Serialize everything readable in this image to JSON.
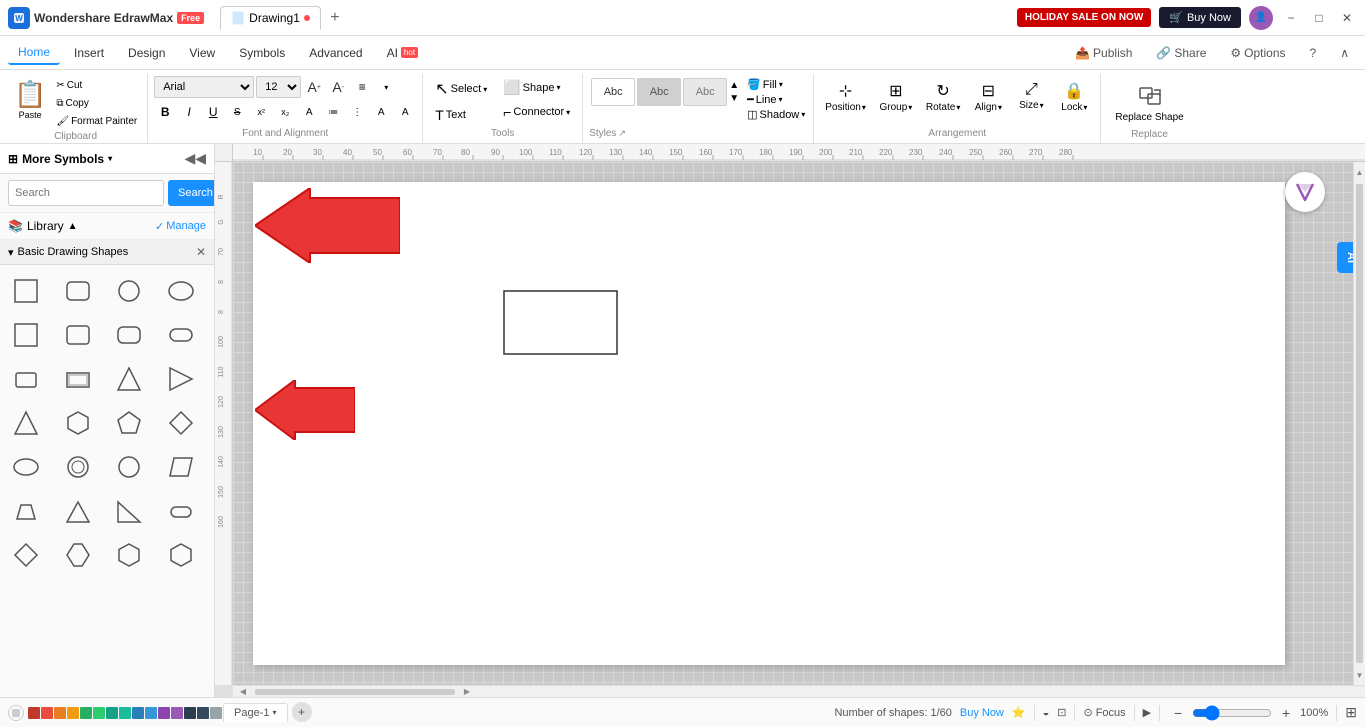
{
  "app": {
    "name": "Wondershare EdrawMax",
    "badge": "Free",
    "window_title": "Drawing1"
  },
  "titlebar": {
    "logo_text": "W",
    "app_name": "Wondershare EdrawMax",
    "free_label": "Free",
    "tab_name": "Drawing1",
    "holiday_btn": "HOLIDAY SALE ON NOW",
    "buy_btn": "Buy Now",
    "minimize": "−",
    "maximize": "□",
    "close": "✕"
  },
  "menubar": {
    "items": [
      {
        "label": "Home",
        "active": true
      },
      {
        "label": "Insert"
      },
      {
        "label": "Design"
      },
      {
        "label": "View"
      },
      {
        "label": "Symbols"
      },
      {
        "label": "Advanced"
      },
      {
        "label": "AI",
        "badge": "hot"
      }
    ],
    "right_actions": [
      {
        "label": "Publish"
      },
      {
        "label": "Share"
      },
      {
        "label": "Options"
      },
      {
        "label": "?"
      }
    ]
  },
  "ribbon": {
    "clipboard": {
      "label": "Clipboard",
      "paste_label": "Paste",
      "cut_label": "Cut",
      "copy_label": "Copy",
      "format_painter": "Format Painter"
    },
    "font": {
      "label": "Font and Alignment",
      "font_family": "Arial",
      "font_size": "12",
      "bold": "B",
      "italic": "I",
      "underline": "U",
      "strikethrough": "S",
      "superscript": "x²",
      "subscript": "x₂",
      "increase_size": "A+",
      "decrease_size": "A-",
      "align": "≡"
    },
    "tools": {
      "label": "Tools",
      "select_label": "Select",
      "shape_label": "Shape",
      "text_label": "Text",
      "connector_label": "Connector"
    },
    "styles": {
      "label": "Styles",
      "fill_label": "Fill",
      "line_label": "Line",
      "shadow_label": "Shadow"
    },
    "arrangement": {
      "label": "Arrangement",
      "position_label": "Position",
      "group_label": "Group",
      "rotate_label": "Rotate",
      "align_label": "Align",
      "size_label": "Size",
      "lock_label": "Lock"
    },
    "replace": {
      "label": "Replace",
      "replace_shape_label": "Replace Shape"
    }
  },
  "sidebar": {
    "title": "More Symbols",
    "search_placeholder": "Search",
    "search_btn": "Search",
    "library_label": "Library",
    "manage_label": "Manage",
    "shapes_section": "Basic Drawing Shapes",
    "shapes": [
      "square",
      "rounded-rect",
      "circle",
      "oval",
      "square2",
      "rounded-rect2",
      "rect-rounded",
      "stadium",
      "squircle",
      "rect-dark",
      "triangle",
      "triangle-right",
      "triangle2",
      "hexagon",
      "pentagon",
      "diamond",
      "ellipse",
      "circle-outline",
      "circle-outline2",
      "parallelogram",
      "trapezoid",
      "triangle3",
      "triangle4",
      "pill",
      "diamond2",
      "hexagon2",
      "hexagon3",
      "hexagon4"
    ]
  },
  "canvas": {
    "ruler_marks": [
      "10",
      "20",
      "30",
      "40",
      "50",
      "60",
      "70",
      "80",
      "90",
      "100",
      "110",
      "120",
      "130",
      "140",
      "150",
      "160",
      "170",
      "180",
      "190",
      "200",
      "210",
      "220",
      "230",
      "240",
      "250",
      "260",
      "270",
      "280"
    ],
    "ruler_v_marks": [
      "R",
      "G",
      "70",
      "8",
      "8",
      "100",
      "110",
      "120",
      "130",
      "140",
      "150",
      "160"
    ]
  },
  "statusbar": {
    "shape_count": "Number of shapes: 1/60",
    "buy_label": "Buy Now",
    "focus_label": "Focus",
    "zoom_level": "100%",
    "page_label": "Page-1"
  },
  "colors": {
    "primary": "#1890ff",
    "danger": "#ff4d4f",
    "arrow_fill": "#e8352a",
    "arrow_stroke": "#cc2200"
  }
}
